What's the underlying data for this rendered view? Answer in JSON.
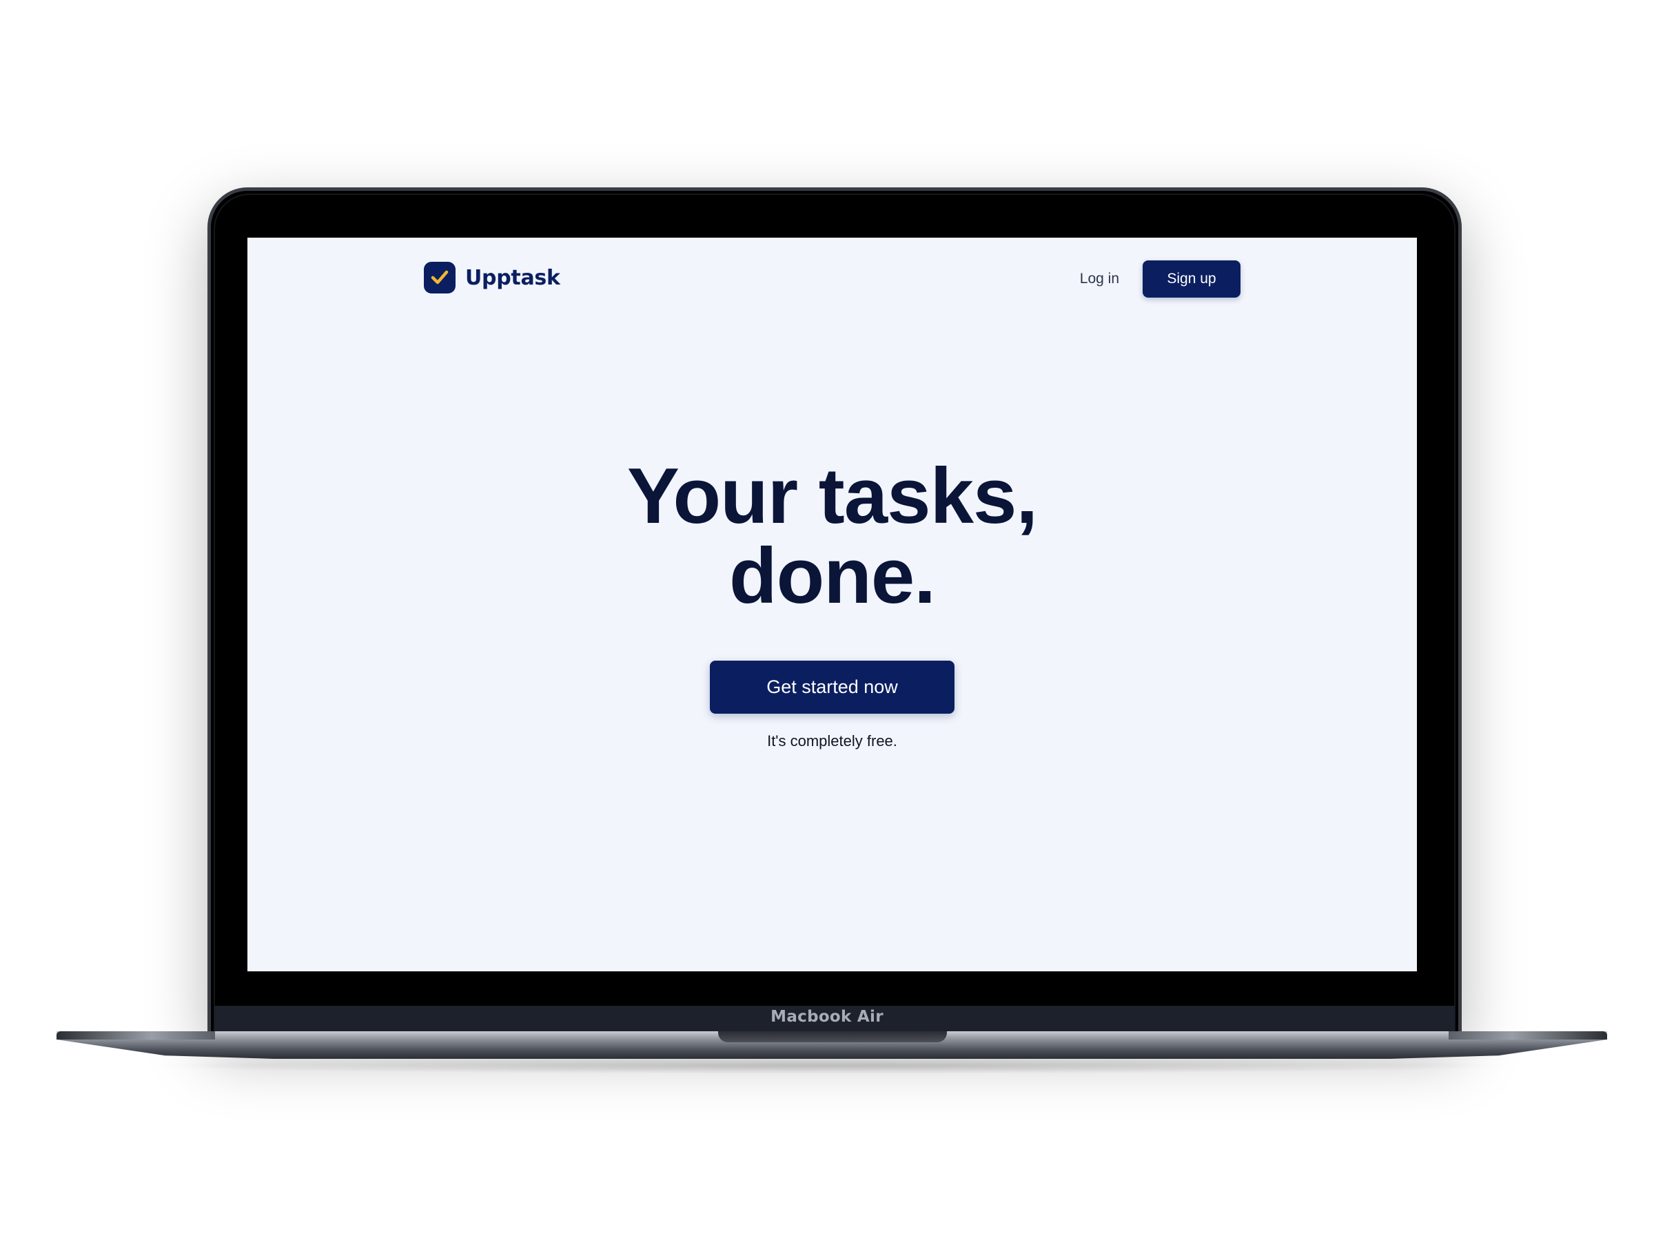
{
  "device": {
    "label": "Macbook Air"
  },
  "site": {
    "brand": "Upptask",
    "logo_icon": "checkmark-icon",
    "colors": {
      "primary": "#0b1f60",
      "accent": "#f2b632",
      "background": "#f2f5fc",
      "heading": "#0a1538"
    },
    "nav": {
      "login_label": "Log in",
      "signup_label": "Sign up"
    },
    "hero": {
      "title_line1": "Your tasks,",
      "title_line2": "done.",
      "cta_label": "Get started now",
      "note": "It's completely free."
    }
  }
}
